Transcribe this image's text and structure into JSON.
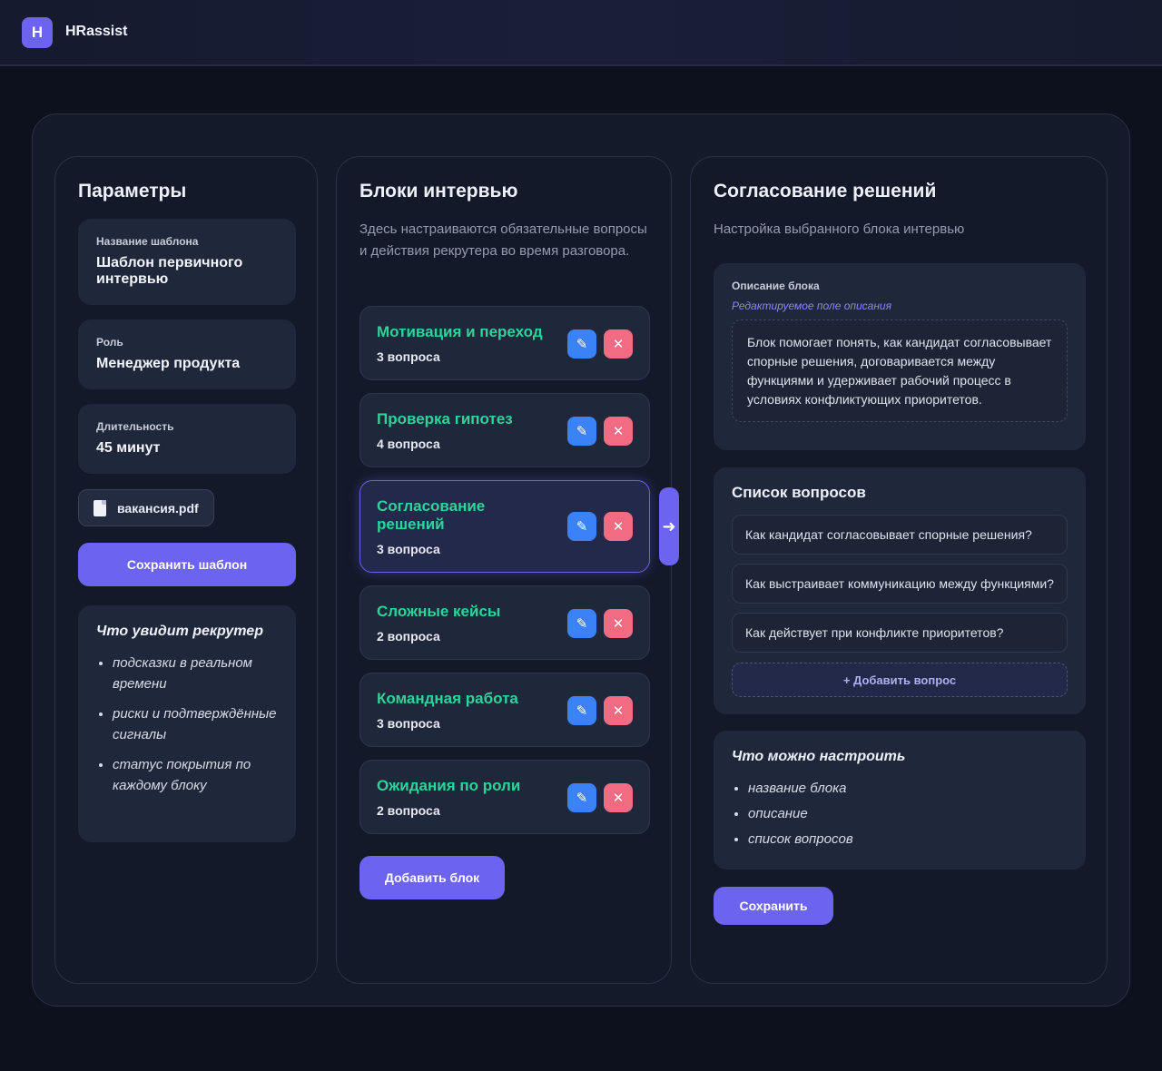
{
  "app": {
    "logo_letter": "H",
    "name": "HRassist"
  },
  "params": {
    "title": "Параметры",
    "fields": [
      {
        "label": "Название шаблона",
        "value": "Шаблон первичного интервью"
      },
      {
        "label": "Роль",
        "value": "Менеджер продукта"
      },
      {
        "label": "Длительность",
        "value": "45 минут"
      }
    ],
    "file_name": "вакансия.pdf",
    "save_label": "Сохранить шаблон",
    "info_title": "Что увидит рекрутер",
    "info_items": [
      "подсказки в реальном времени",
      "риски и подтверждённые сигналы",
      "статус покрытия по каждому блоку"
    ]
  },
  "blocks": {
    "title": "Блоки интервью",
    "subtitle": "Здесь настраиваются обязательные вопросы и действия рекрутера во время разговора.",
    "items": [
      {
        "title": "Мотивация и переход",
        "count": "3 вопроса"
      },
      {
        "title": "Проверка гипотез",
        "count": "4 вопроса"
      },
      {
        "title": "Согласование решений",
        "count": "3 вопроса"
      },
      {
        "title": "Сложные кейсы",
        "count": "2 вопроса"
      },
      {
        "title": "Командная работа",
        "count": "3 вопроса"
      },
      {
        "title": "Ожидания по роли",
        "count": "2 вопроса"
      }
    ],
    "edit_glyph": "✎",
    "delete_glyph": "✕",
    "arrow_glyph": "➜",
    "add_label": "Добавить блок"
  },
  "detail": {
    "title": "Согласование решений",
    "subtitle": "Настройка выбранного блока интервью",
    "desc_label": "Описание блока",
    "desc_hint": "Редактируемое поле описания",
    "desc_text": "Блок помогает понять, как кандидат согласовывает спорные решения, договаривается между функциями и удерживает рабочий процесс в условиях конфликтующих приоритетов.",
    "questions_title": "Список вопросов",
    "questions": [
      "Как кандидат согласовывает спорные решения?",
      "Как выстраивает коммуникацию между функциями?",
      "Как действует при конфликте приоритетов?"
    ],
    "add_question_label": "+ Добавить вопрос",
    "config_title": "Что можно настроить",
    "config_items": [
      "название блока",
      "описание",
      "список вопросов"
    ],
    "save_label": "Сохранить"
  },
  "colors": {
    "accent": "#6c63f0",
    "success": "#2fd39a",
    "edit": "#3b82f6",
    "danger": "#f16b82"
  }
}
